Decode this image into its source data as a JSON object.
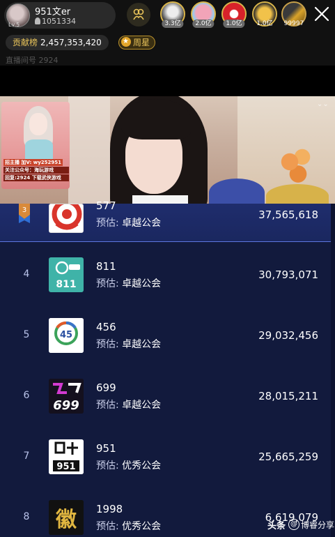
{
  "anchor": {
    "name": "951文er",
    "fans": "1051334",
    "level": "Lv.5"
  },
  "fans_top": [
    {
      "value": "3.3亿"
    },
    {
      "value": "2.0亿"
    },
    {
      "value": "1.0亿"
    },
    {
      "value": "1.0亿"
    },
    {
      "value": "99997"
    }
  ],
  "contribution": {
    "label": "贡献榜",
    "value": "2,457,353,420"
  },
  "week_star": "周星",
  "room_id": "直播间号 2924",
  "video_ad": {
    "line1": "招主播 加V: wy252951",
    "line2": "关注公众号：海玩游戏",
    "line3": "回复:2924 下载武侠游戏"
  },
  "ranking": {
    "est_label": "预估:",
    "rows": [
      {
        "rank": "3",
        "name": "577",
        "guild": "卓越公会",
        "value": "37,565,618",
        "logo": "ring"
      },
      {
        "rank": "4",
        "name": "811",
        "guild": "卓越公会",
        "value": "30,793,071",
        "logo": "811"
      },
      {
        "rank": "5",
        "name": "456",
        "guild": "卓越公会",
        "value": "29,032,456",
        "logo": "456"
      },
      {
        "rank": "6",
        "name": "699",
        "guild": "卓越公会",
        "value": "28,015,211",
        "logo": "699"
      },
      {
        "rank": "7",
        "name": "951",
        "guild": "优秀公会",
        "value": "25,665,259",
        "logo": "951"
      },
      {
        "rank": "8",
        "name": "1998",
        "guild": "优秀公会",
        "value": "6,619,079",
        "logo": "1998"
      }
    ]
  },
  "logo_texts": {
    "l811": "811",
    "l456": "45",
    "l699": "699",
    "l951": "951",
    "l1998": "徽"
  },
  "watermark": {
    "brand": "头条",
    "author": "博睿分享"
  }
}
